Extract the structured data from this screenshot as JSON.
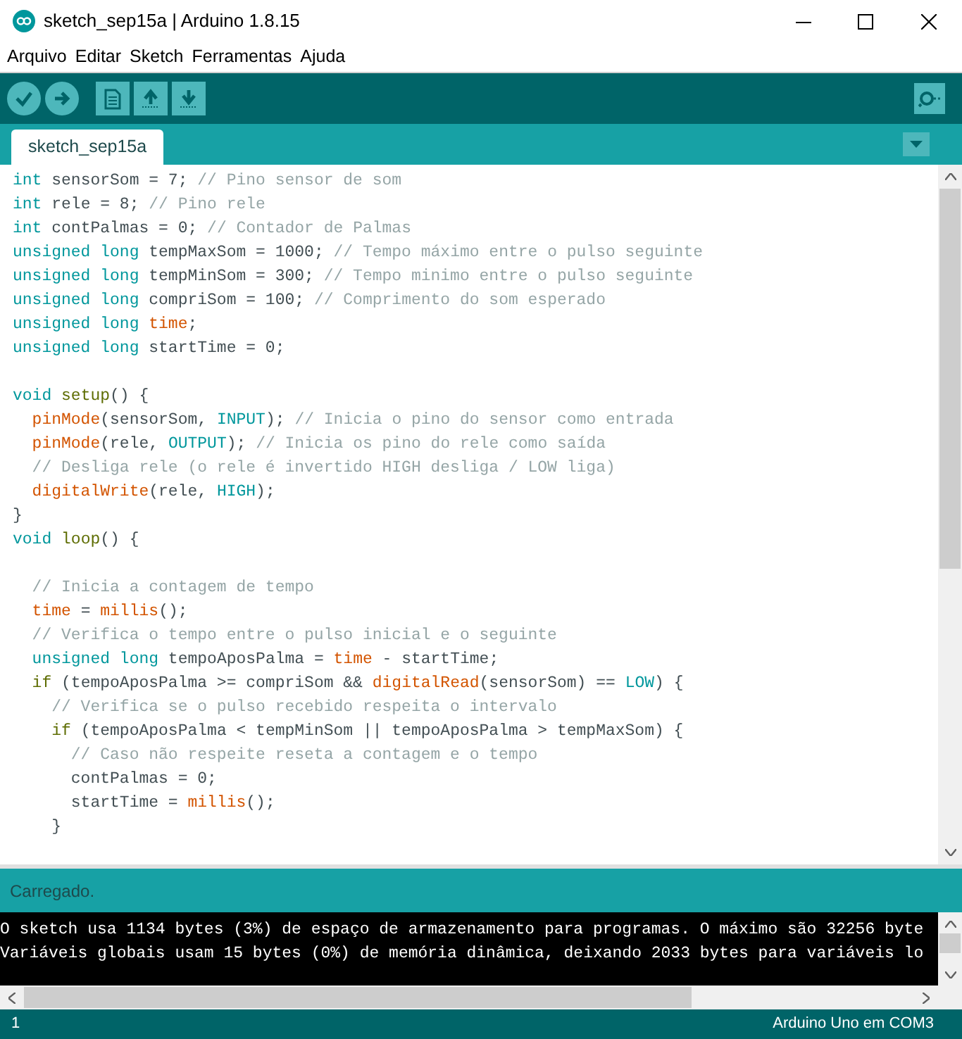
{
  "window": {
    "title": "sketch_sep15a | Arduino 1.8.15"
  },
  "menu": [
    "Arquivo",
    "Editar",
    "Sketch",
    "Ferramentas",
    "Ajuda"
  ],
  "tabs": [
    {
      "label": "sketch_sep15a",
      "selected": true
    }
  ],
  "editor": {
    "lines": [
      {
        "kind": "code",
        "tokens": [
          {
            "kind": "type",
            "text": "int"
          },
          {
            "kind": "text",
            "text": " sensorSom = 7; "
          },
          {
            "kind": "comment",
            "text": "// Pino sensor de som"
          }
        ]
      },
      {
        "kind": "code",
        "tokens": [
          {
            "kind": "type",
            "text": "int"
          },
          {
            "kind": "text",
            "text": " rele = 8; "
          },
          {
            "kind": "comment",
            "text": "// Pino rele"
          }
        ]
      },
      {
        "kind": "code",
        "tokens": [
          {
            "kind": "type",
            "text": "int"
          },
          {
            "kind": "text",
            "text": " contPalmas = 0; "
          },
          {
            "kind": "comment",
            "text": "// Contador de Palmas"
          }
        ]
      },
      {
        "kind": "code",
        "tokens": [
          {
            "kind": "type",
            "text": "unsigned long"
          },
          {
            "kind": "text",
            "text": " tempMaxSom = 1000; "
          },
          {
            "kind": "comment",
            "text": "// Tempo máximo entre o pulso seguinte"
          }
        ]
      },
      {
        "kind": "code",
        "tokens": [
          {
            "kind": "type",
            "text": "unsigned long"
          },
          {
            "kind": "text",
            "text": " tempMinSom = 300; "
          },
          {
            "kind": "comment",
            "text": "// Tempo minimo entre o pulso seguinte"
          }
        ]
      },
      {
        "kind": "code",
        "tokens": [
          {
            "kind": "type",
            "text": "unsigned long"
          },
          {
            "kind": "text",
            "text": " compriSom = 100; "
          },
          {
            "kind": "comment",
            "text": "// Comprimento do som esperado"
          }
        ]
      },
      {
        "kind": "code",
        "tokens": [
          {
            "kind": "type",
            "text": "unsigned long"
          },
          {
            "kind": "fn",
            "text": " time"
          },
          {
            "kind": "text",
            "text": ";"
          }
        ]
      },
      {
        "kind": "code",
        "tokens": [
          {
            "kind": "type",
            "text": "unsigned long"
          },
          {
            "kind": "text",
            "text": " startTime = 0;"
          }
        ]
      },
      {
        "kind": "blank"
      },
      {
        "kind": "code",
        "tokens": [
          {
            "kind": "type",
            "text": "void"
          },
          {
            "kind": "control",
            "text": " setup"
          },
          {
            "kind": "text",
            "text": "() {"
          }
        ]
      },
      {
        "kind": "code",
        "tokens": [
          {
            "kind": "fn",
            "text": "  pinMode"
          },
          {
            "kind": "text",
            "text": "(sensorSom, "
          },
          {
            "kind": "const",
            "text": "INPUT"
          },
          {
            "kind": "text",
            "text": "); "
          },
          {
            "kind": "comment",
            "text": "// Inicia o pino do sensor como entrada"
          }
        ]
      },
      {
        "kind": "code",
        "tokens": [
          {
            "kind": "fn",
            "text": "  pinMode"
          },
          {
            "kind": "text",
            "text": "(rele, "
          },
          {
            "kind": "const",
            "text": "OUTPUT"
          },
          {
            "kind": "text",
            "text": "); "
          },
          {
            "kind": "comment",
            "text": "// Inicia os pino do rele como saída"
          }
        ]
      },
      {
        "kind": "code",
        "tokens": [
          {
            "kind": "comment",
            "text": "  // Desliga rele (o rele é invertido HIGH desliga / LOW liga)"
          }
        ]
      },
      {
        "kind": "code",
        "tokens": [
          {
            "kind": "fn",
            "text": "  digitalWrite"
          },
          {
            "kind": "text",
            "text": "(rele, "
          },
          {
            "kind": "const",
            "text": "HIGH"
          },
          {
            "kind": "text",
            "text": ");"
          }
        ]
      },
      {
        "kind": "code",
        "tokens": [
          {
            "kind": "text",
            "text": "}"
          }
        ]
      },
      {
        "kind": "code",
        "tokens": [
          {
            "kind": "type",
            "text": "void"
          },
          {
            "kind": "control",
            "text": " loop"
          },
          {
            "kind": "text",
            "text": "() {"
          }
        ]
      },
      {
        "kind": "blank"
      },
      {
        "kind": "code",
        "tokens": [
          {
            "kind": "comment",
            "text": "  // Inicia a contagem de tempo"
          }
        ]
      },
      {
        "kind": "code",
        "tokens": [
          {
            "kind": "fn",
            "text": "  time"
          },
          {
            "kind": "text",
            "text": " = "
          },
          {
            "kind": "fn",
            "text": "millis"
          },
          {
            "kind": "text",
            "text": "();"
          }
        ]
      },
      {
        "kind": "code",
        "tokens": [
          {
            "kind": "comment",
            "text": "  // Verifica o tempo entre o pulso inicial e o seguinte"
          }
        ]
      },
      {
        "kind": "code",
        "tokens": [
          {
            "kind": "type",
            "text": "  unsigned long"
          },
          {
            "kind": "text",
            "text": " tempoAposPalma = "
          },
          {
            "kind": "fn",
            "text": "time"
          },
          {
            "kind": "text",
            "text": " - startTime;"
          }
        ]
      },
      {
        "kind": "code",
        "tokens": [
          {
            "kind": "control",
            "text": "  if"
          },
          {
            "kind": "text",
            "text": " (tempoAposPalma >= compriSom && "
          },
          {
            "kind": "fn",
            "text": "digitalRead"
          },
          {
            "kind": "text",
            "text": "(sensorSom) == "
          },
          {
            "kind": "const",
            "text": "LOW"
          },
          {
            "kind": "text",
            "text": ") {"
          }
        ]
      },
      {
        "kind": "code",
        "tokens": [
          {
            "kind": "comment",
            "text": "    // Verifica se o pulso recebido respeita o intervalo"
          }
        ]
      },
      {
        "kind": "code",
        "tokens": [
          {
            "kind": "control",
            "text": "    if"
          },
          {
            "kind": "text",
            "text": " (tempoAposPalma < tempMinSom || tempoAposPalma > tempMaxSom) {"
          }
        ]
      },
      {
        "kind": "code",
        "tokens": [
          {
            "kind": "comment",
            "text": "      // Caso não respeite reseta a contagem e o tempo"
          }
        ]
      },
      {
        "kind": "code",
        "tokens": [
          {
            "kind": "text",
            "text": "      contPalmas = 0;"
          }
        ]
      },
      {
        "kind": "code",
        "tokens": [
          {
            "kind": "text",
            "text": "      startTime = "
          },
          {
            "kind": "fn",
            "text": "millis"
          },
          {
            "kind": "text",
            "text": "();"
          }
        ]
      },
      {
        "kind": "code",
        "tokens": [
          {
            "kind": "text",
            "text": "    }"
          }
        ]
      }
    ]
  },
  "status": {
    "message": "Carregado."
  },
  "console": {
    "lines": [
      "O sketch usa 1134 bytes (3%) de espaço de armazenamento para programas. O máximo são 32256 byte",
      "Variáveis globais usam 15 bytes (0%) de memória dinâmica, deixando 2033 bytes para variáveis lo"
    ]
  },
  "status_bar": {
    "line": "1",
    "board": "Arduino Uno em COM3"
  }
}
